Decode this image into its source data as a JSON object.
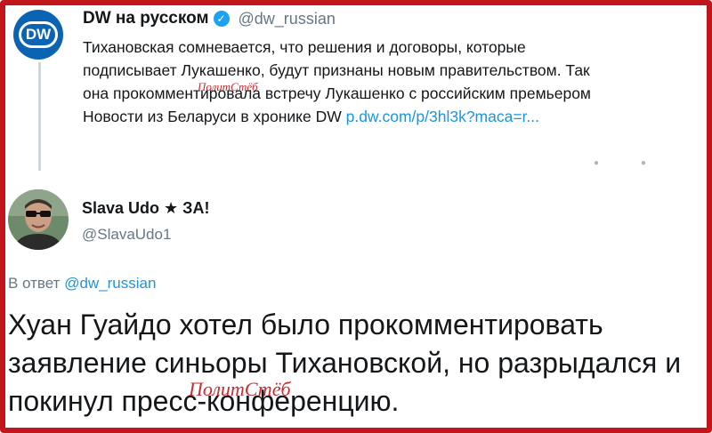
{
  "quoted_tweet": {
    "author_name": "DW на русском",
    "author_handle": "@dw_russian",
    "avatar_label": "DW",
    "text_lines": [
      "Тихановская сомневается, что решения и договоры, которые",
      "подписывает Лукашенко, будут признаны новым правительством. Так",
      "она прокомментировала встречу Лукашенко с российским премьером",
      "Новости из Беларуси в хронике DW "
    ],
    "link": "p.dw.com/p/3hl3k?maca=r..."
  },
  "reply_tweet": {
    "author_name": "Slava Udo ★ ЗА!",
    "author_handle": "@SlavaUdo1",
    "reply_to_prefix": "В ответ",
    "reply_to_handle": "@dw_russian",
    "text_lines": [
      "Хуан Гуайдо хотел было прокомментировать",
      "заявление синьоры Тихановской, но разрыдался и",
      "покинул пресс-конференцию."
    ]
  },
  "watermark": "ПолитСтёб",
  "colors": {
    "frame": "#c0161c",
    "link": "#1b95e0",
    "verified": "#1da1f2",
    "dw_blue": "#0a64b3"
  }
}
